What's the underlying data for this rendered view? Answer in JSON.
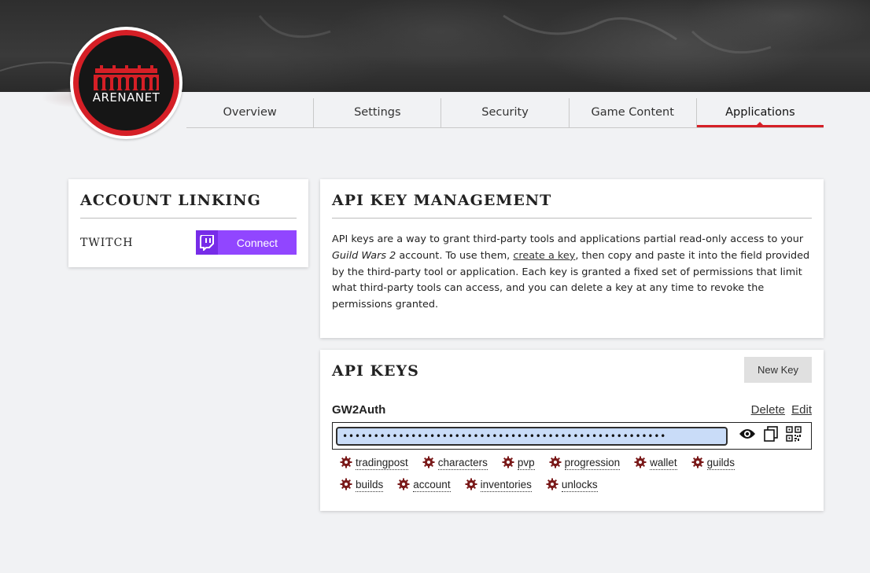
{
  "brand": {
    "logo_text": "ARENANET",
    "accent": "#d51f26"
  },
  "nav": {
    "tabs": [
      {
        "label": "Overview"
      },
      {
        "label": "Settings"
      },
      {
        "label": "Security"
      },
      {
        "label": "Game Content"
      },
      {
        "label": "Applications",
        "active": true
      }
    ]
  },
  "account_linking": {
    "title": "ACCOUNT LINKING",
    "twitch_label": "TWITCH",
    "connect_label": "Connect",
    "twitch_color": "#9146ff"
  },
  "api_management": {
    "title": "API KEY MANAGEMENT",
    "text_1": "API keys are a way to grant third-party tools and applications partial read-only access to your ",
    "game_name": "Guild Wars 2",
    "text_2": " account. To use them, ",
    "link": "create a key",
    "text_3": ", then copy and paste it into the field provided by the third-party tool or application. Each key is granted a fixed set of permissions that limit what third-party tools can access, and you can delete a key at any time to revoke the permissions granted."
  },
  "api_keys": {
    "title": "API KEYS",
    "new_key_label": "New Key",
    "keys": [
      {
        "name": "GW2Auth",
        "delete_label": "Delete",
        "edit_label": "Edit",
        "masked_value": "••••••••••••••••••••••••••••••••••••••••••••••••••••",
        "permissions": [
          "tradingpost",
          "characters",
          "pvp",
          "progression",
          "wallet",
          "guilds",
          "builds",
          "account",
          "inventories",
          "unlocks"
        ]
      }
    ]
  }
}
